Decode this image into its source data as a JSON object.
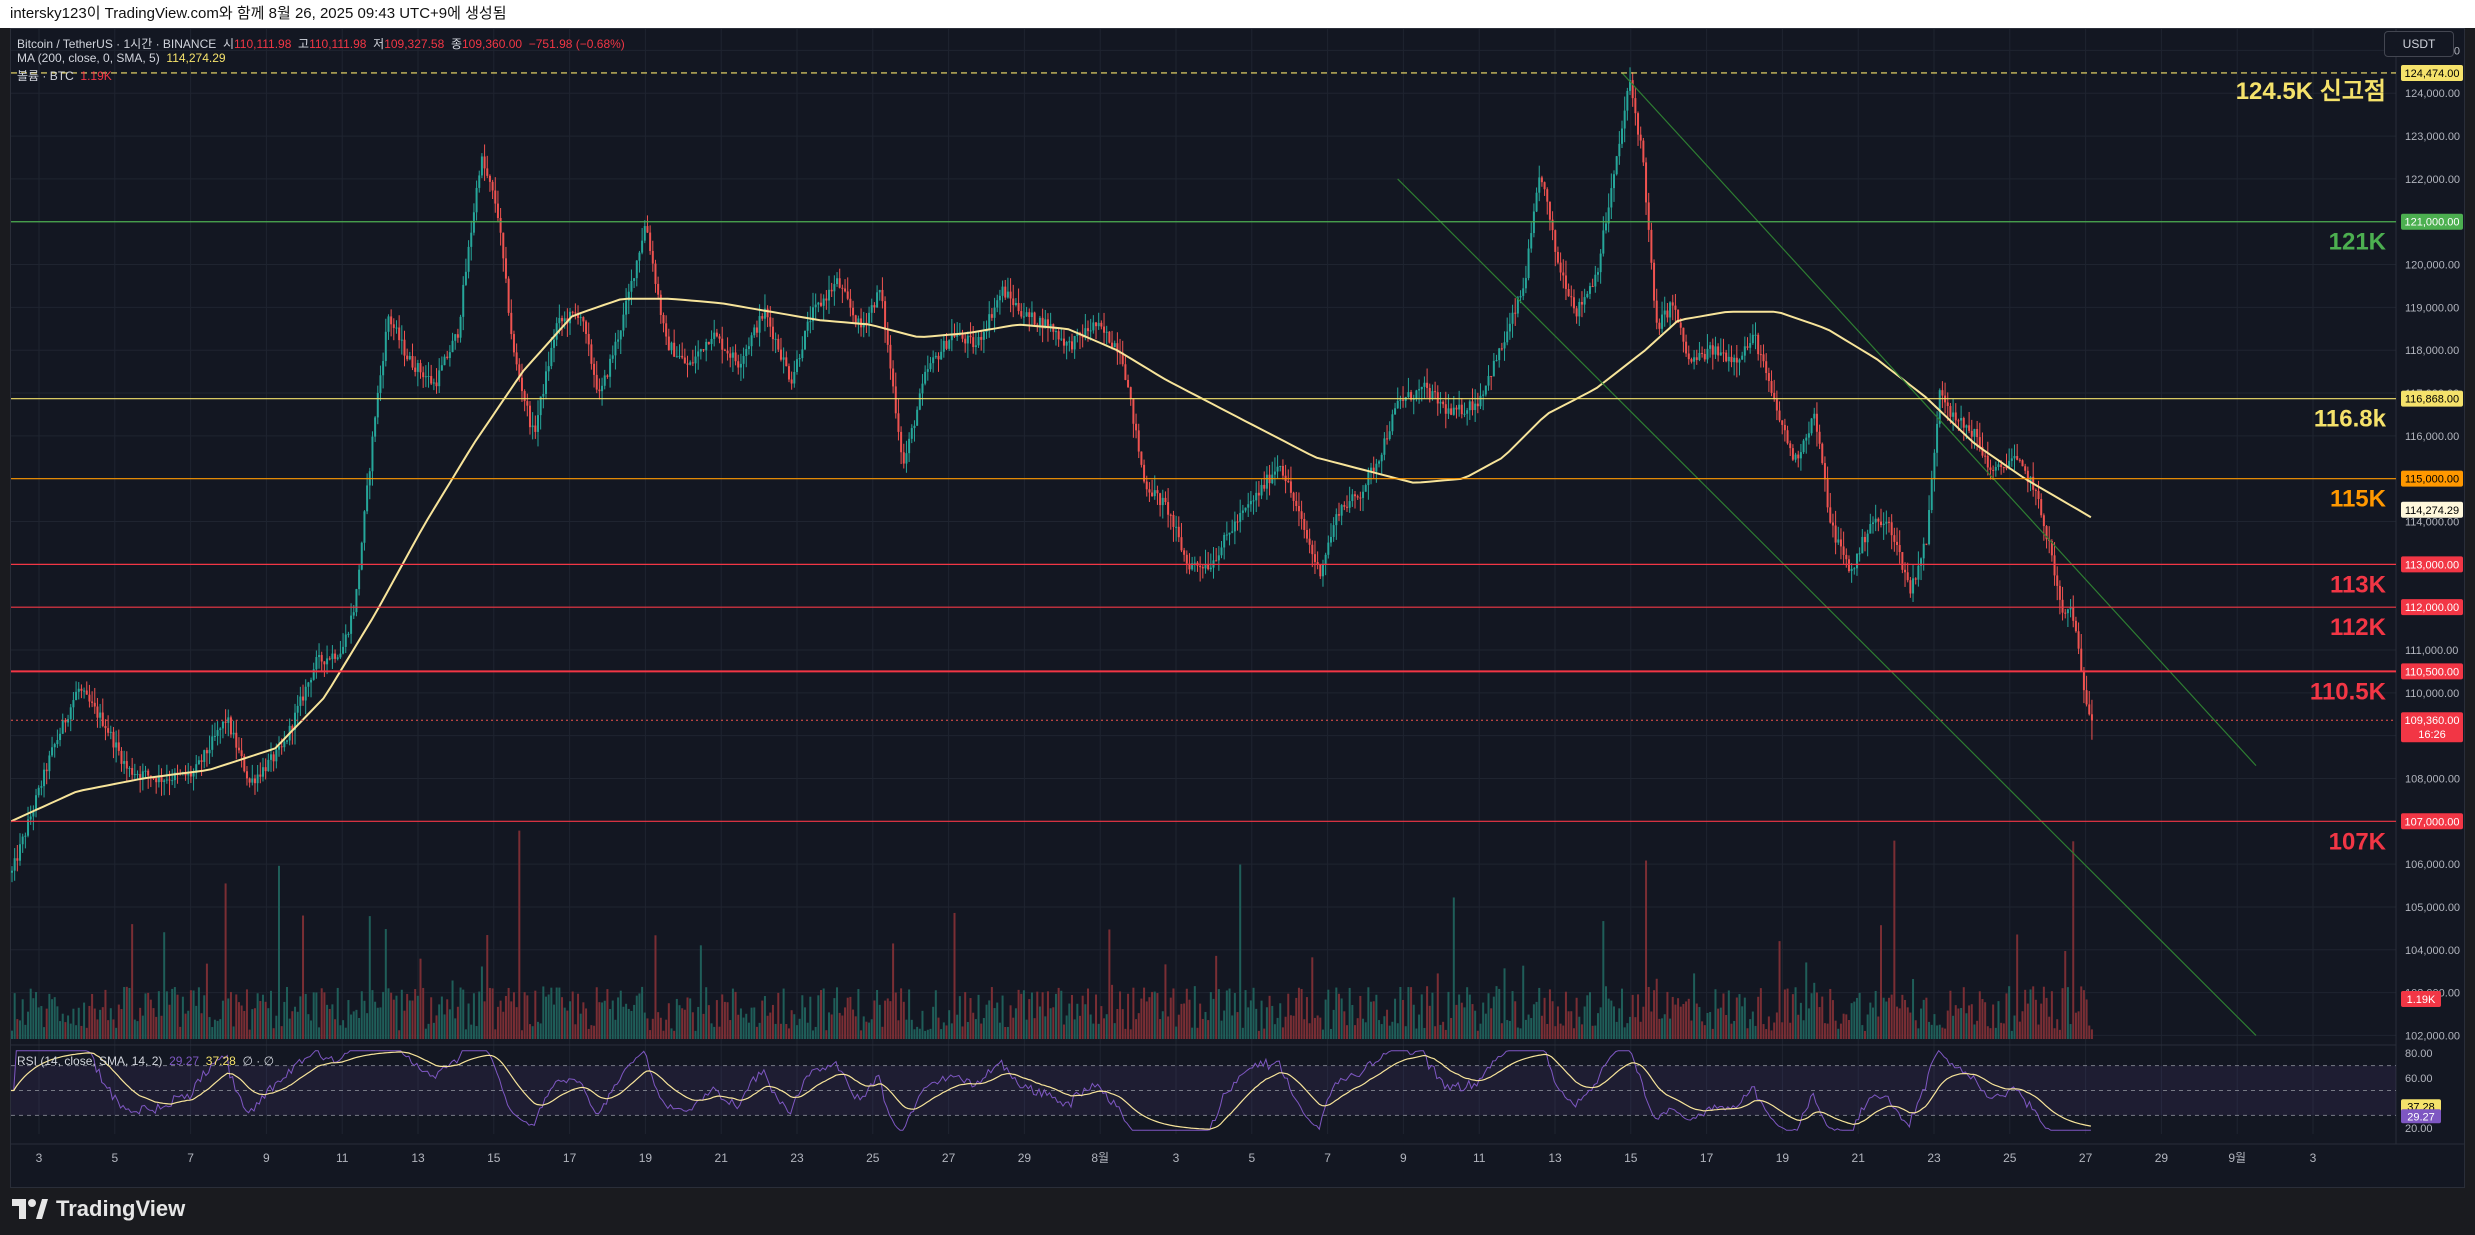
{
  "header": {
    "title": "intersky123이 TradingView.com와 함께 8월 26, 2025 09:43 UTC+9에 생성됨"
  },
  "symbol": {
    "name": "Bitcoin / TetherUS · 1시간 · BINANCE",
    "o_label": "시",
    "o": "110,111.98",
    "h_label": "고",
    "h": "110,111.98",
    "l_label": "저",
    "l": "109,327.58",
    "c_label": "종",
    "c": "109,360.00",
    "change": "−751.98 (−0.68%)"
  },
  "ma": {
    "label": "MA (200, close, 0, SMA, 5)",
    "value": "114,274.29"
  },
  "volume": {
    "label": "볼륨 · BTC",
    "value": "1.19K"
  },
  "rsi": {
    "label": "RSI (14, close, SMA, 14, 2)",
    "v1": "29.27",
    "v2": "37.28",
    "extra": "∅ · ∅"
  },
  "currency": "USDT",
  "brand": "TradingView",
  "colors": {
    "bg": "#131722",
    "up": "#26a69a",
    "down": "#ef5350",
    "ma": "#f7e49a",
    "grid": "#1f2430",
    "green": "#4caf50",
    "yellow": "#f5e26b",
    "orange": "#ff9800",
    "red": "#f23645",
    "rsi_line": "#7e57c2",
    "rsi_ma": "#f7e49a"
  },
  "chart_data": {
    "type": "candlestick",
    "timeframe": "1h",
    "x_ticks": [
      "3",
      "5",
      "7",
      "9",
      "11",
      "13",
      "15",
      "17",
      "19",
      "21",
      "23",
      "25",
      "27",
      "29",
      "8월",
      "3",
      "5",
      "7",
      "9",
      "11",
      "13",
      "15",
      "17",
      "19",
      "21",
      "23",
      "25",
      "27",
      "29",
      "9월",
      "3"
    ],
    "y_ticks": [
      102000,
      103000,
      104000,
      105000,
      106000,
      107000,
      108000,
      109000,
      110000,
      111000,
      112000,
      113000,
      114000,
      115000,
      116000,
      117000,
      118000,
      119000,
      120000,
      121000,
      122000,
      123000,
      124000,
      125000
    ],
    "y_tick_labels": [
      "102,000.00",
      "103,000.00",
      "104,000.00",
      "105,000.00",
      "106,000.00",
      "107,000.00",
      "108,000.00",
      "109,000.00",
      "110,000.00",
      "111,000.00",
      "112,000.00",
      "113,000.00",
      "114,000.00",
      "115,000.00",
      "116,000.00",
      "117,000.00",
      "118,000.00",
      "119,000.00",
      "120,000.00",
      "121,000.00",
      "122,000.00",
      "123,000.00",
      "124,000.00",
      "125,000.00"
    ],
    "ylim": [
      101800,
      125500
    ],
    "price_path": [
      [
        0,
        105800
      ],
      [
        6,
        107200
      ],
      [
        12,
        108600
      ],
      [
        20,
        110100
      ],
      [
        28,
        109300
      ],
      [
        35,
        108200
      ],
      [
        45,
        108000
      ],
      [
        55,
        108100
      ],
      [
        65,
        109400
      ],
      [
        72,
        107900
      ],
      [
        82,
        108700
      ],
      [
        92,
        110700
      ],
      [
        100,
        111000
      ],
      [
        104,
        112100
      ],
      [
        110,
        116500
      ],
      [
        114,
        118800
      ],
      [
        120,
        117800
      ],
      [
        128,
        117200
      ],
      [
        135,
        118400
      ],
      [
        142,
        122500
      ],
      [
        147,
        121300
      ],
      [
        152,
        117900
      ],
      [
        158,
        116000
      ],
      [
        165,
        118600
      ],
      [
        172,
        118900
      ],
      [
        178,
        116900
      ],
      [
        185,
        118700
      ],
      [
        192,
        121000
      ],
      [
        198,
        118200
      ],
      [
        205,
        117600
      ],
      [
        212,
        118400
      ],
      [
        220,
        117700
      ],
      [
        228,
        118900
      ],
      [
        236,
        117300
      ],
      [
        242,
        118800
      ],
      [
        250,
        119600
      ],
      [
        257,
        118500
      ],
      [
        263,
        119400
      ],
      [
        270,
        115300
      ],
      [
        277,
        117500
      ],
      [
        285,
        118400
      ],
      [
        292,
        118100
      ],
      [
        300,
        119400
      ],
      [
        307,
        118800
      ],
      [
        314,
        118600
      ],
      [
        320,
        118100
      ],
      [
        328,
        118600
      ],
      [
        336,
        118000
      ],
      [
        343,
        114900
      ],
      [
        350,
        114300
      ],
      [
        356,
        113000
      ],
      [
        363,
        113000
      ],
      [
        370,
        113900
      ],
      [
        378,
        114700
      ],
      [
        384,
        115400
      ],
      [
        390,
        114100
      ],
      [
        396,
        112800
      ],
      [
        402,
        114300
      ],
      [
        408,
        114600
      ],
      [
        414,
        115500
      ],
      [
        420,
        116800
      ],
      [
        428,
        117100
      ],
      [
        436,
        116500
      ],
      [
        444,
        116800
      ],
      [
        452,
        118200
      ],
      [
        458,
        119500
      ],
      [
        463,
        122200
      ],
      [
        468,
        120100
      ],
      [
        474,
        118900
      ],
      [
        480,
        119800
      ],
      [
        486,
        122400
      ],
      [
        490,
        124300
      ],
      [
        494,
        122500
      ],
      [
        498,
        118500
      ],
      [
        503,
        119100
      ],
      [
        508,
        117700
      ],
      [
        515,
        118000
      ],
      [
        522,
        117800
      ],
      [
        528,
        118300
      ],
      [
        534,
        116700
      ],
      [
        540,
        115400
      ],
      [
        546,
        116500
      ],
      [
        551,
        113900
      ],
      [
        557,
        112800
      ],
      [
        563,
        114000
      ],
      [
        569,
        113900
      ],
      [
        575,
        112400
      ],
      [
        580,
        113600
      ],
      [
        584,
        117200
      ],
      [
        588,
        116400
      ],
      [
        594,
        116100
      ],
      [
        600,
        115100
      ],
      [
        606,
        115500
      ],
      [
        612,
        114900
      ],
      [
        617,
        113500
      ],
      [
        621,
        111800
      ],
      [
        624,
        112000
      ],
      [
        627,
        110300
      ],
      [
        630,
        109360
      ]
    ],
    "ma_path": [
      [
        0,
        107000
      ],
      [
        20,
        107700
      ],
      [
        40,
        108000
      ],
      [
        60,
        108200
      ],
      [
        80,
        108700
      ],
      [
        95,
        109900
      ],
      [
        110,
        111800
      ],
      [
        125,
        113900
      ],
      [
        140,
        115800
      ],
      [
        155,
        117500
      ],
      [
        170,
        118800
      ],
      [
        185,
        119200
      ],
      [
        200,
        119200
      ],
      [
        215,
        119100
      ],
      [
        230,
        118900
      ],
      [
        245,
        118700
      ],
      [
        260,
        118600
      ],
      [
        275,
        118300
      ],
      [
        290,
        118400
      ],
      [
        305,
        118600
      ],
      [
        320,
        118500
      ],
      [
        335,
        118000
      ],
      [
        350,
        117300
      ],
      [
        365,
        116700
      ],
      [
        380,
        116100
      ],
      [
        395,
        115500
      ],
      [
        410,
        115200
      ],
      [
        425,
        114900
      ],
      [
        440,
        115000
      ],
      [
        452,
        115500
      ],
      [
        465,
        116500
      ],
      [
        480,
        117100
      ],
      [
        495,
        118000
      ],
      [
        505,
        118700
      ],
      [
        520,
        118900
      ],
      [
        535,
        118900
      ],
      [
        550,
        118500
      ],
      [
        565,
        117800
      ],
      [
        580,
        116900
      ],
      [
        595,
        115800
      ],
      [
        610,
        115000
      ],
      [
        630,
        114100
      ]
    ],
    "last_price": 109360,
    "ma_value": 114274.29,
    "levels": [
      {
        "price": 124474,
        "label": "124.5K 신고점",
        "axis_label": "124,474.00",
        "color": "#f5e26b",
        "dashed": true
      },
      {
        "price": 121000,
        "label": "121K",
        "axis_label": "121,000.00",
        "color": "#4caf50"
      },
      {
        "price": 116868,
        "label": "116.8k",
        "axis_label": "116,868.00",
        "color": "#f5e26b"
      },
      {
        "price": 115000,
        "label": "115K",
        "axis_label": "115,000.00",
        "color": "#ff9800"
      },
      {
        "price": 113000,
        "label": "113K",
        "axis_label": "113,000.00",
        "color": "#f23645"
      },
      {
        "price": 112000,
        "label": "112K",
        "axis_label": "112,000.00",
        "color": "#f23645"
      },
      {
        "price": 110500,
        "label": "110.5K",
        "axis_label": "110,500.00",
        "color": "#f23645"
      },
      {
        "price": 107000,
        "label": "107K",
        "axis_label": "107,000.00",
        "color": "#f23645"
      }
    ],
    "last_price_label": "109,360.00",
    "countdown": "16:26",
    "ma_axis_label": "114,274.29",
    "volume_axis_label": "1.19K",
    "rsi_ticks": [
      "80.00",
      "60.00",
      "40.00",
      "20.00"
    ],
    "rsi_axis_labels": [
      "37.28",
      "29.27"
    ],
    "channel": {
      "upper": [
        [
          488,
          124474
        ],
        [
          680,
          108300
        ]
      ],
      "lower": [
        [
          420,
          122000
        ],
        [
          680,
          102000
        ]
      ]
    }
  }
}
